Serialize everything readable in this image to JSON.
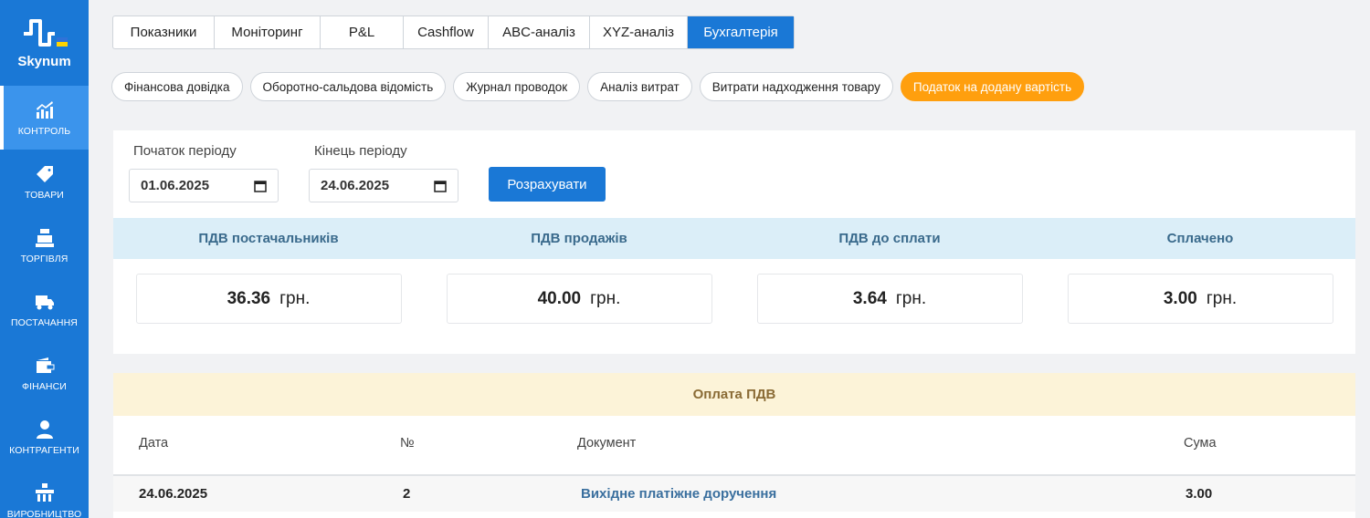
{
  "brand": {
    "name": "Skynum"
  },
  "sidebar": {
    "items": [
      {
        "label": "КОНТРОЛЬ",
        "icon": "chart-icon",
        "active": true
      },
      {
        "label": "ТОВАРИ",
        "icon": "tag-icon",
        "active": false
      },
      {
        "label": "ТОРГІВЛЯ",
        "icon": "cash-register-icon",
        "active": false
      },
      {
        "label": "ПОСТАЧАННЯ",
        "icon": "truck-icon",
        "active": false
      },
      {
        "label": "ФІНАНСИ",
        "icon": "wallet-icon",
        "active": false
      },
      {
        "label": "КОНТРАГЕНТИ",
        "icon": "user-icon",
        "active": false
      },
      {
        "label": "ВИРОБНИЦТВО",
        "icon": "factory-icon",
        "active": false
      }
    ]
  },
  "tabs": [
    {
      "label": "Показники",
      "active": false
    },
    {
      "label": "Моніторинг",
      "active": false
    },
    {
      "label": "P&L",
      "active": false
    },
    {
      "label": "Cashflow",
      "active": false
    },
    {
      "label": "ABC-аналіз",
      "active": false
    },
    {
      "label": "XYZ-аналіз",
      "active": false
    },
    {
      "label": "Бухгалтерія",
      "active": true
    }
  ],
  "subtabs": [
    {
      "label": "Фінансова довідка",
      "active": false
    },
    {
      "label": "Оборотно-сальдова відомість",
      "active": false
    },
    {
      "label": "Журнал проводок",
      "active": false
    },
    {
      "label": "Аналіз витрат",
      "active": false
    },
    {
      "label": "Витрати надходження товару",
      "active": false
    },
    {
      "label": "Податок на додану вартість",
      "active": true
    }
  ],
  "period": {
    "start_label": "Початок періоду",
    "start_value": "01.06.2025",
    "end_label": "Кінець періоду",
    "end_value": "24.06.2025",
    "calculate_label": "Розрахувати"
  },
  "vat_summary": {
    "currency": "грн.",
    "columns": [
      {
        "title": "ПДВ постачальників",
        "value": "36.36"
      },
      {
        "title": "ПДВ продажів",
        "value": "40.00"
      },
      {
        "title": "ПДВ до сплати",
        "value": "3.64"
      },
      {
        "title": "Сплачено",
        "value": "3.00"
      }
    ]
  },
  "payments": {
    "title": "Оплата ПДВ",
    "headers": {
      "date": "Дата",
      "number": "№",
      "document": "Документ",
      "amount": "Сума"
    },
    "rows": [
      {
        "date": "24.06.2025",
        "number": "2",
        "document": "Вихідне платіжне доручення",
        "amount": "3.00"
      }
    ]
  },
  "colors": {
    "primary": "#1a78d6",
    "accent": "#ff9f0e",
    "vat_header_bg": "#dbeef8",
    "payment_header_bg": "#fcf3d8"
  }
}
